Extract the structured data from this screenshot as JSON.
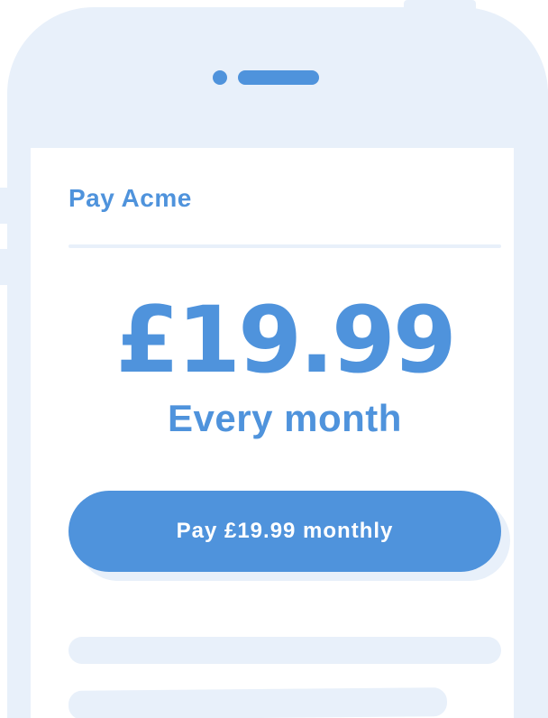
{
  "payment": {
    "merchant_title": "Pay Acme",
    "amount": "£19.99",
    "period": "Every month",
    "pay_button_label": "Pay £19.99 monthly"
  },
  "colors": {
    "accent": "#4f93dc",
    "device_frame": "#e8f0fa",
    "screen_background": "#ffffff"
  }
}
